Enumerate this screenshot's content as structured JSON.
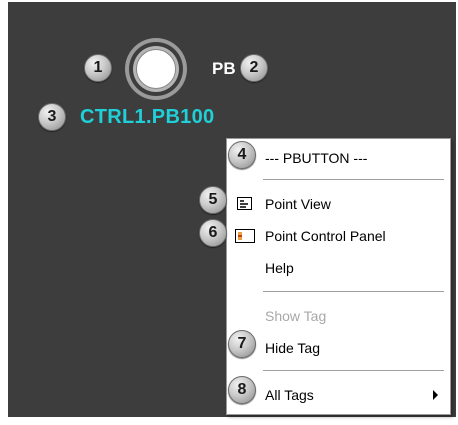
{
  "canvas": {
    "pushbutton_label": "PB",
    "tag_name": "CTRL1.PB100"
  },
  "callouts": [
    "1",
    "2",
    "3",
    "4",
    "5",
    "6",
    "7",
    "8"
  ],
  "context_menu": {
    "header": "--- PBUTTON ---",
    "items": [
      {
        "label": "Point View",
        "icon": "point-view-icon"
      },
      {
        "label": "Point Control Panel",
        "icon": "point-control-panel-icon"
      },
      {
        "label": "Help"
      },
      {
        "label": "Show Tag",
        "disabled": true
      },
      {
        "label": "Hide Tag"
      },
      {
        "label": "All Tags",
        "submenu": true
      }
    ]
  },
  "colors": {
    "canvas_bg": "#3d3d3d",
    "tag_text": "#1fd0d8",
    "menu_bg": "#ffffff"
  }
}
